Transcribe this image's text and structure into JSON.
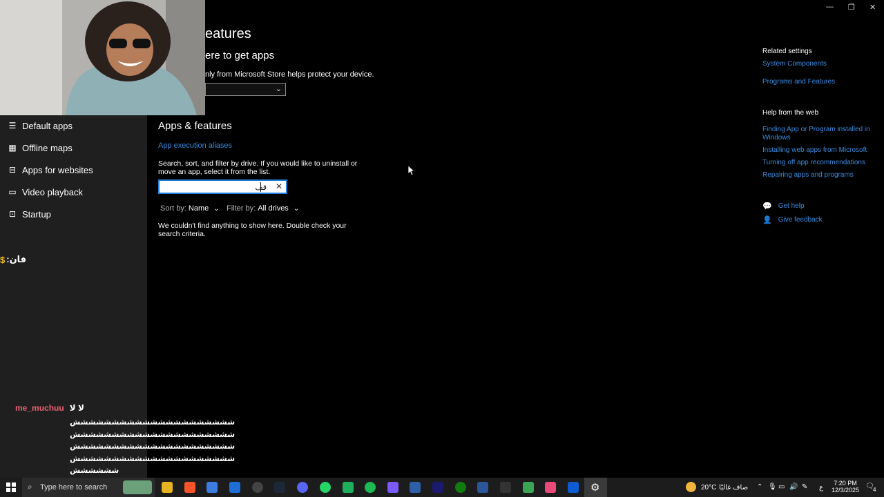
{
  "window": {
    "minimize_glyph": "—",
    "restore_glyph": "❐",
    "close_glyph": "✕"
  },
  "sidebar": {
    "items": [
      {
        "label": "Default apps",
        "icon": "default-apps-icon",
        "glyph": "☰"
      },
      {
        "label": "Offline maps",
        "icon": "offline-maps-icon",
        "glyph": "▦"
      },
      {
        "label": "Apps for websites",
        "icon": "apps-websites-icon",
        "glyph": "⊟"
      },
      {
        "label": "Video playback",
        "icon": "video-playback-icon",
        "glyph": "▭"
      },
      {
        "label": "Startup",
        "icon": "startup-icon",
        "glyph": "⊡"
      }
    ]
  },
  "main": {
    "page_title_fragment": "eatures",
    "choose_heading_fragment": "ere to get apps",
    "store_note_fragment": "nly from Microsoft Store helps protect your device.",
    "store_select_value": "",
    "apps_heading": "Apps & features",
    "aliases_link": "App execution aliases",
    "search_help": "Search, sort, and filter by drive. If you would like to uninstall or move an app, select it from the list.",
    "search": {
      "value": "قف",
      "clear_glyph": "✕"
    },
    "sort": {
      "label": "Sort by:",
      "value": "Name"
    },
    "filter": {
      "label": "Filter by:",
      "value": "All drives"
    },
    "empty_message": "We couldn't find anything to show here. Double check your search criteria."
  },
  "related": {
    "heading": "Related settings",
    "links": [
      "System Components",
      "Programs and Features"
    ],
    "help_heading": "Help from the web",
    "help_links": [
      "Finding App or Program installed in Windows",
      "Installing web apps from Microsoft",
      "Turning off app recommendations",
      "Repairing apps and programs"
    ],
    "get_help": "Get help",
    "give_feedback": "Give feedback"
  },
  "overlay": {
    "chat_command": "فان:",
    "chat_currency": "$",
    "chat_user": "me_muchuu",
    "chat_user_msg": "لا لا",
    "chat_lines": [
      "ششششششششششششششششششششش",
      "ششششششششششششششششششششش",
      "ششششششششششششششششششششش",
      "ششششششششششششششششششششش",
      "شششششش"
    ]
  },
  "taskbar": {
    "search_placeholder": "Type here to search",
    "temperature": "20°C",
    "weather": "صاف غالبًا",
    "language": "ع",
    "time": "7:20 PM",
    "date": "12/3/2025",
    "notifications": "4",
    "colors": {
      "brave": "#fb542b",
      "steam": "#1b2838",
      "whatsapp": "#25d366",
      "spotify": "#1db954",
      "xbox": "#107c10",
      "word": "#2b579a",
      "fresco": "#0f5bd4"
    }
  }
}
